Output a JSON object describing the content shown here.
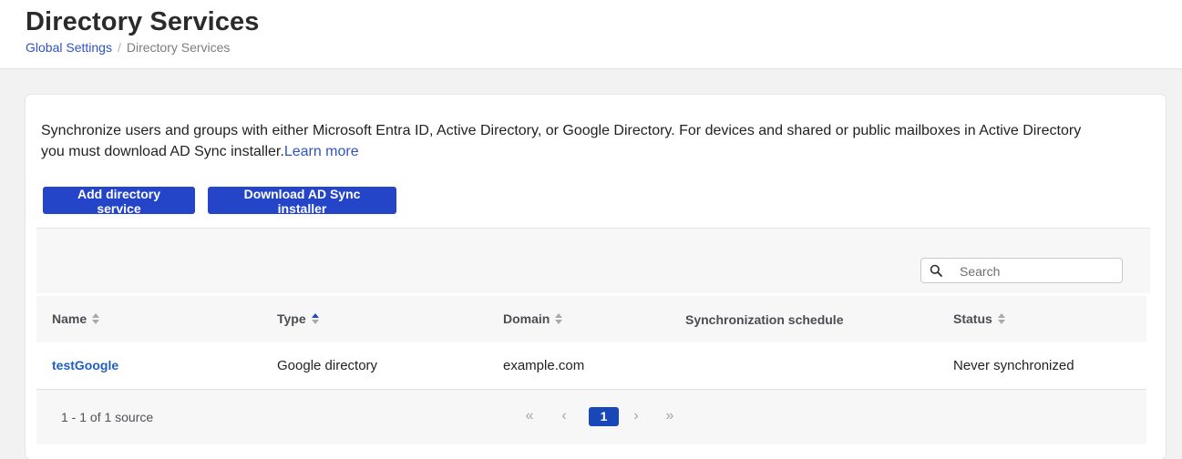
{
  "header": {
    "title": "Directory Services",
    "breadcrumb": {
      "parent": "Global Settings",
      "separator": "/",
      "current": "Directory Services"
    }
  },
  "card": {
    "description": "Synchronize users and groups with either Microsoft Entra ID, Active Directory, or Google Directory. For devices and shared or public mailboxes in Active Directory you must download AD Sync installer.",
    "learn_more": "Learn more",
    "buttons": {
      "add": "Add directory service",
      "download": "Download AD Sync installer"
    }
  },
  "search": {
    "placeholder": "Search",
    "icon": "search-icon"
  },
  "table": {
    "columns": [
      {
        "label": "Name",
        "sortable": true,
        "sort": "none"
      },
      {
        "label": "Type",
        "sortable": true,
        "sort": "asc"
      },
      {
        "label": "Domain",
        "sortable": true,
        "sort": "none"
      },
      {
        "label": "Synchronization schedule",
        "sortable": false,
        "sort": "none"
      },
      {
        "label": "Status",
        "sortable": true,
        "sort": "none"
      }
    ],
    "rows": [
      {
        "name": "testGoogle",
        "type": "Google directory",
        "domain": "example.com",
        "schedule": "",
        "status": "Never synchronized"
      }
    ]
  },
  "pagination": {
    "range_text": "1 - 1 of 1 source",
    "current_page": "1",
    "first": "«",
    "prev": "‹",
    "next": "›",
    "last": "»"
  },
  "colors": {
    "accent": "#2545c8",
    "link": "#2f52c9",
    "page_bg": "#f2f2f3"
  }
}
